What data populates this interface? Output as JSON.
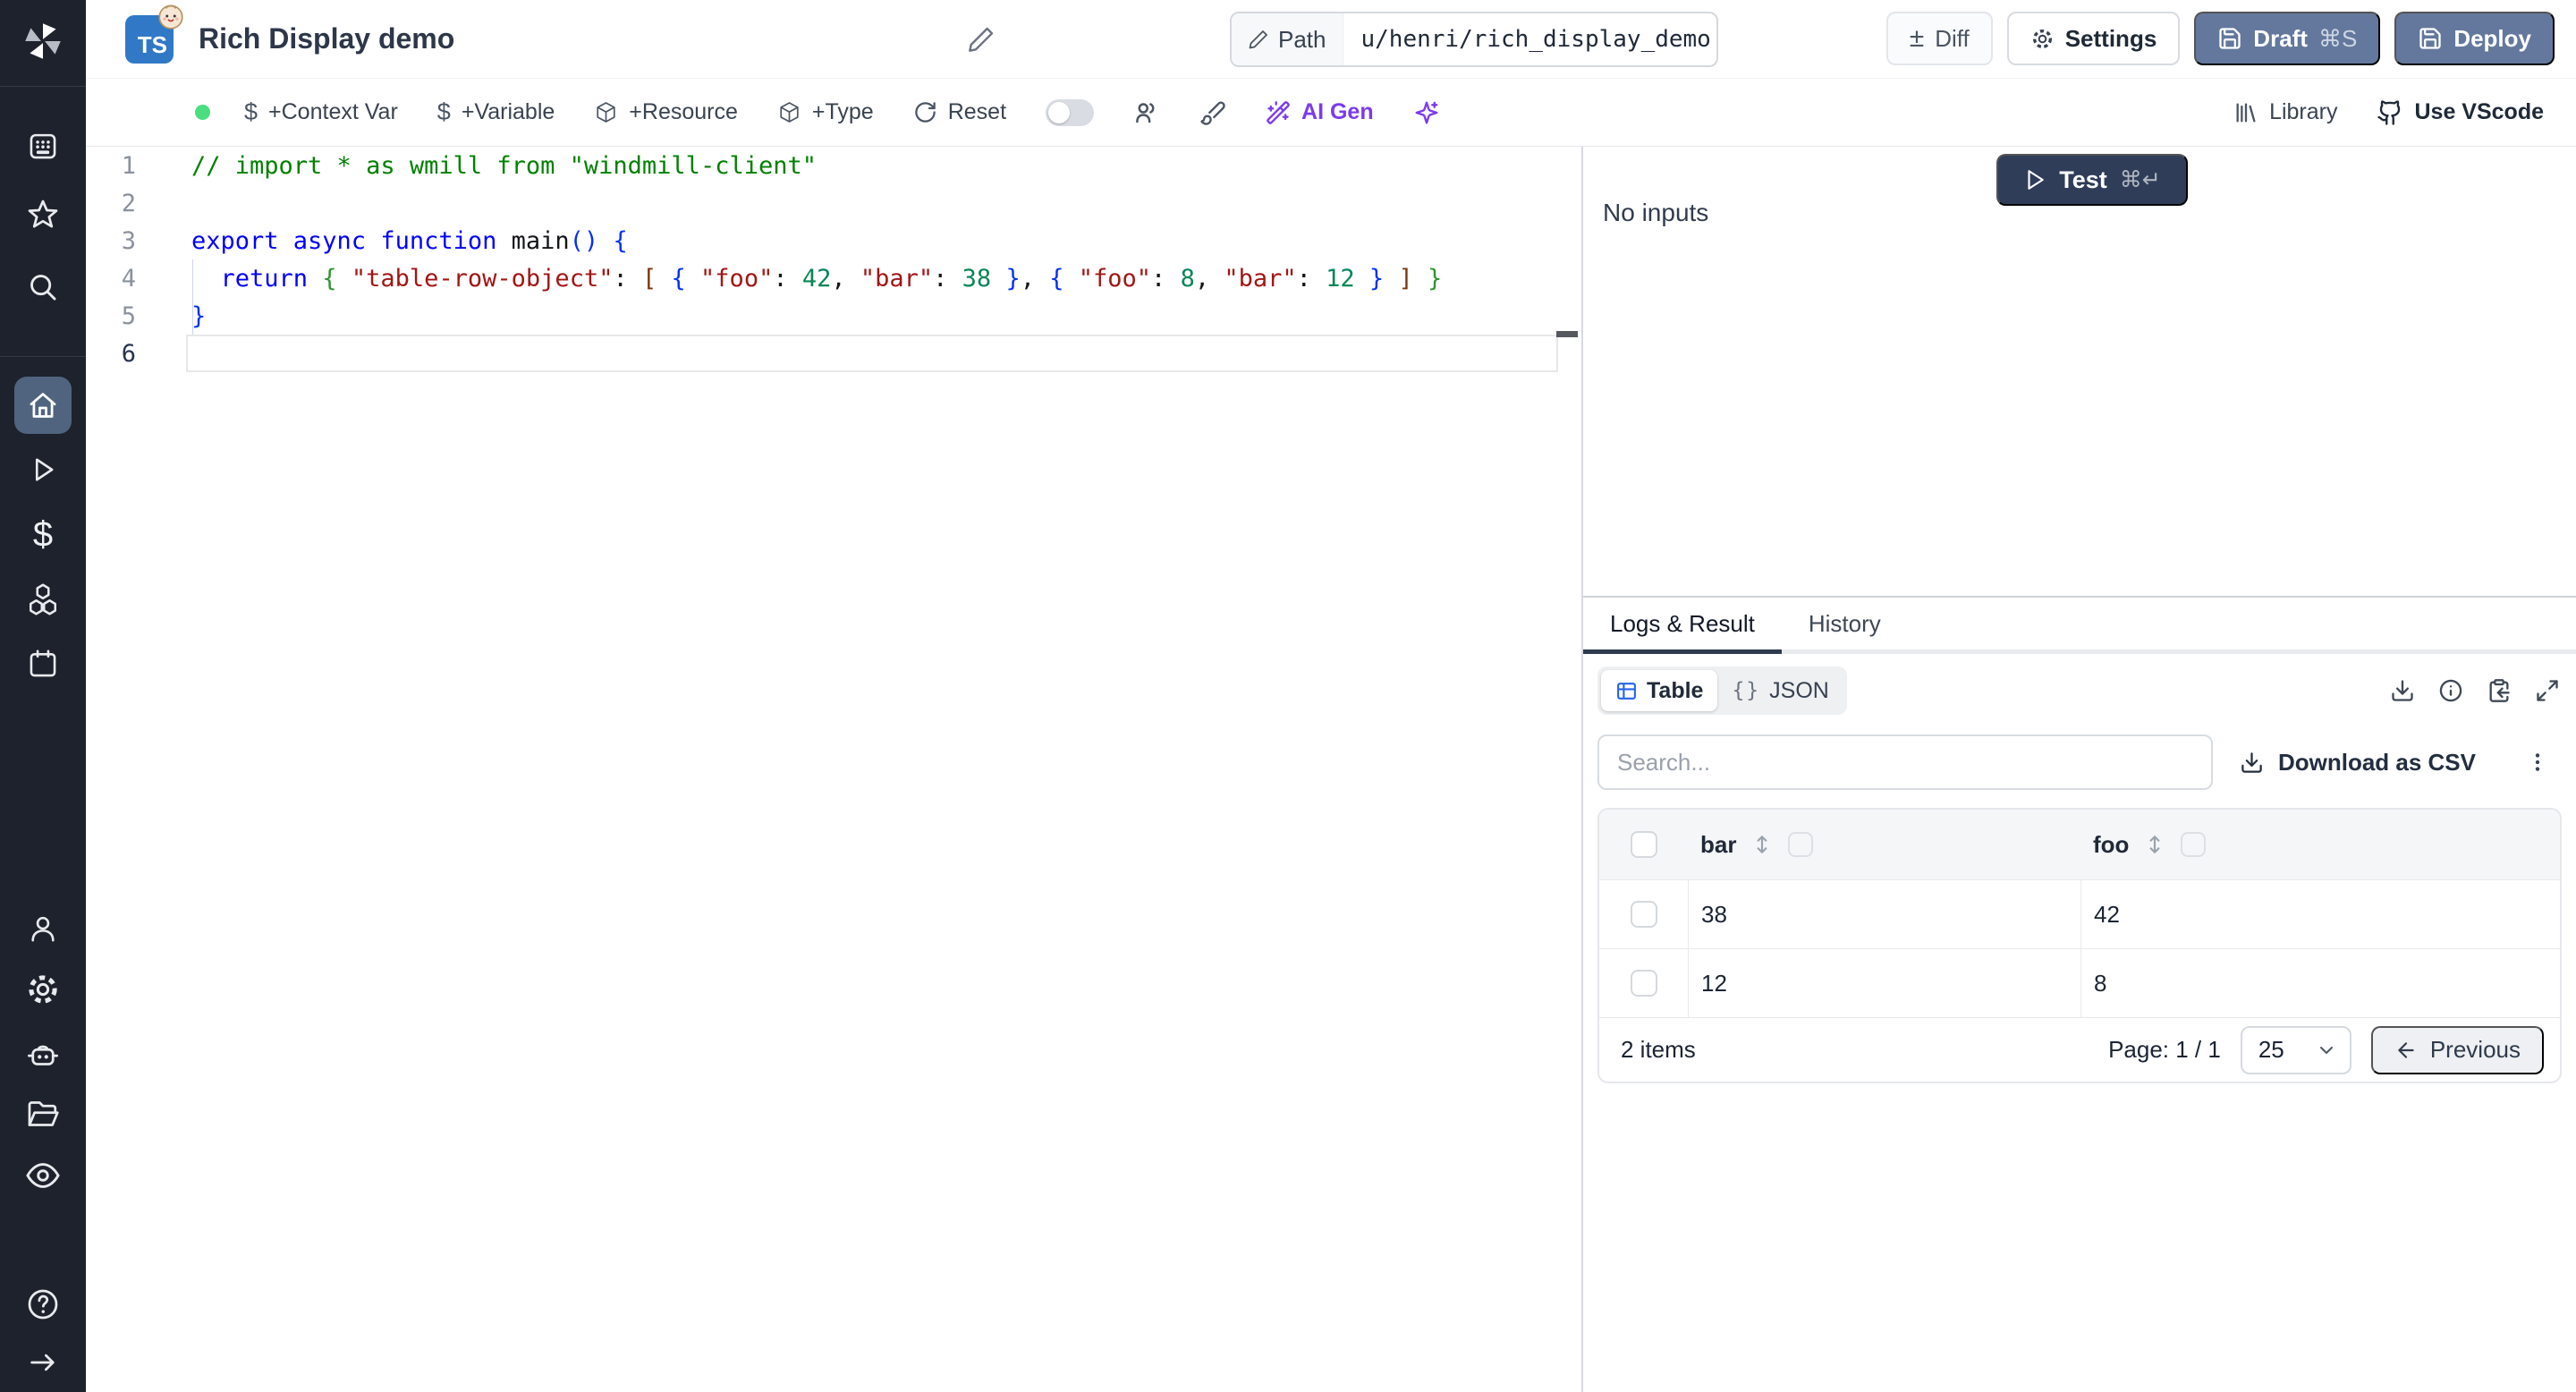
{
  "header": {
    "language_badge": "TS",
    "title": "Rich Display demo",
    "path_label": "Path",
    "path_value": "u/henri/rich_display_demo",
    "diff_label": "Diff",
    "diff_icon": "±",
    "settings_label": "Settings",
    "draft_label": "Draft",
    "draft_shortcut": "⌘S",
    "deploy_label": "Deploy"
  },
  "toolbar": {
    "add_context_var": "+Context Var",
    "add_variable": "+Variable",
    "add_resource": "+Resource",
    "add_type": "+Type",
    "reset": "Reset",
    "ai_gen": "AI Gen",
    "library": "Library",
    "use_vscode": "Use VScode",
    "dollar_icon": "$"
  },
  "editor": {
    "lines": [
      {
        "num": "1",
        "tokens": [
          [
            "comment",
            "// import * as wmill from \"windmill-client\""
          ]
        ]
      },
      {
        "num": "2",
        "tokens": []
      },
      {
        "num": "3",
        "tokens": [
          [
            "kw",
            "export async function "
          ],
          [
            "fn",
            "main"
          ],
          [
            "b1",
            "()"
          ],
          [
            "plain",
            " "
          ],
          [
            "b1",
            "{"
          ]
        ]
      },
      {
        "num": "4",
        "tokens": [
          [
            "plain",
            "  "
          ],
          [
            "kw",
            "return"
          ],
          [
            "plain",
            " "
          ],
          [
            "b2",
            "{"
          ],
          [
            "plain",
            " "
          ],
          [
            "str",
            "\"table-row-object\""
          ],
          [
            "plain",
            ": "
          ],
          [
            "b3",
            "["
          ],
          [
            "plain",
            " "
          ],
          [
            "b1",
            "{"
          ],
          [
            "plain",
            " "
          ],
          [
            "str",
            "\"foo\""
          ],
          [
            "plain",
            ": "
          ],
          [
            "num",
            "42"
          ],
          [
            "plain",
            ", "
          ],
          [
            "str",
            "\"bar\""
          ],
          [
            "plain",
            ": "
          ],
          [
            "num",
            "38"
          ],
          [
            "plain",
            " "
          ],
          [
            "b1",
            "}"
          ],
          [
            "plain",
            ", "
          ],
          [
            "b1",
            "{"
          ],
          [
            "plain",
            " "
          ],
          [
            "str",
            "\"foo\""
          ],
          [
            "plain",
            ": "
          ],
          [
            "num",
            "8"
          ],
          [
            "plain",
            ", "
          ],
          [
            "str",
            "\"bar\""
          ],
          [
            "plain",
            ": "
          ],
          [
            "num",
            "12"
          ],
          [
            "plain",
            " "
          ],
          [
            "b1",
            "}"
          ],
          [
            "plain",
            " "
          ],
          [
            "b3",
            "]"
          ],
          [
            "plain",
            " "
          ],
          [
            "b2",
            "}"
          ]
        ]
      },
      {
        "num": "5",
        "tokens": [
          [
            "b1",
            "}"
          ]
        ]
      },
      {
        "num": "6",
        "tokens": [],
        "current": true
      }
    ]
  },
  "run_panel": {
    "test_label": "Test",
    "test_shortcut": "⌘↵",
    "no_inputs_label": "No inputs"
  },
  "result_panel": {
    "tabs": [
      {
        "label": "Logs & Result",
        "active": true
      },
      {
        "label": "History",
        "active": false
      }
    ],
    "views": [
      {
        "label": "Table",
        "active": true
      },
      {
        "label": "JSON",
        "active": false
      }
    ],
    "json_braces_icon": "{}",
    "search_placeholder": "Search...",
    "download_csv_label": "Download as CSV",
    "kebab_icon": "⋮",
    "table": {
      "columns": [
        "bar",
        "foo"
      ],
      "rows": [
        [
          "38",
          "42"
        ],
        [
          "12",
          "8"
        ]
      ],
      "items_label": "2 items",
      "page_label": "Page: 1 / 1",
      "page_size": "25",
      "previous_label": "Previous"
    }
  },
  "colors": {
    "accent_button": "#64789d",
    "test_button": "#2f3d59",
    "ai_purple": "#7c3aed",
    "status_green": "#4ade80",
    "ts_badge_blue": "#3178c6",
    "table_icon_blue": "#2563eb",
    "sidebar_bg": "#1e222c",
    "sidebar_active": "#50647f"
  }
}
